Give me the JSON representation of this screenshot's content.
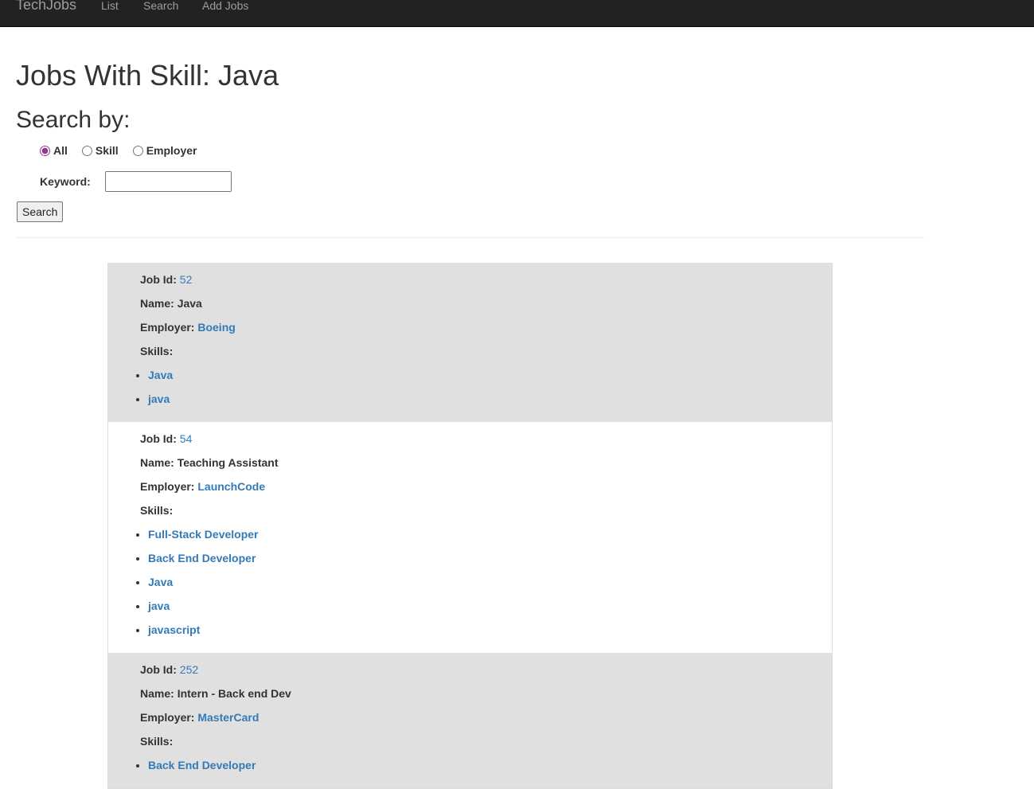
{
  "nav": {
    "brand": "TechJobs",
    "links": [
      "List",
      "Search",
      "Add Jobs"
    ]
  },
  "title": "Jobs With Skill: Java",
  "search": {
    "heading": "Search by:",
    "options": [
      {
        "label": "All",
        "checked": true
      },
      {
        "label": "Skill",
        "checked": false
      },
      {
        "label": "Employer",
        "checked": false
      }
    ],
    "keyword_label": "Keyword:",
    "keyword_value": "",
    "button": "Search"
  },
  "labels": {
    "job_id": "Job Id:",
    "name": "Name:",
    "employer": "Employer:",
    "skills": "Skills:"
  },
  "jobs": [
    {
      "id": "52",
      "name": "Java",
      "employer": "Boeing",
      "skills": [
        "Java",
        "java"
      ]
    },
    {
      "id": "54",
      "name": "Teaching Assistant",
      "employer": "LaunchCode",
      "skills": [
        "Full-Stack Developer",
        "Back End Developer",
        "Java",
        "java",
        "javascript"
      ]
    },
    {
      "id": "252",
      "name": "Intern - Back end Dev",
      "employer": "MasterCard",
      "skills": [
        "Back End Developer"
      ]
    }
  ],
  "colors": {
    "navbar": "#222222",
    "link": "#337ab7",
    "row_alt": "#e0e0e0"
  }
}
